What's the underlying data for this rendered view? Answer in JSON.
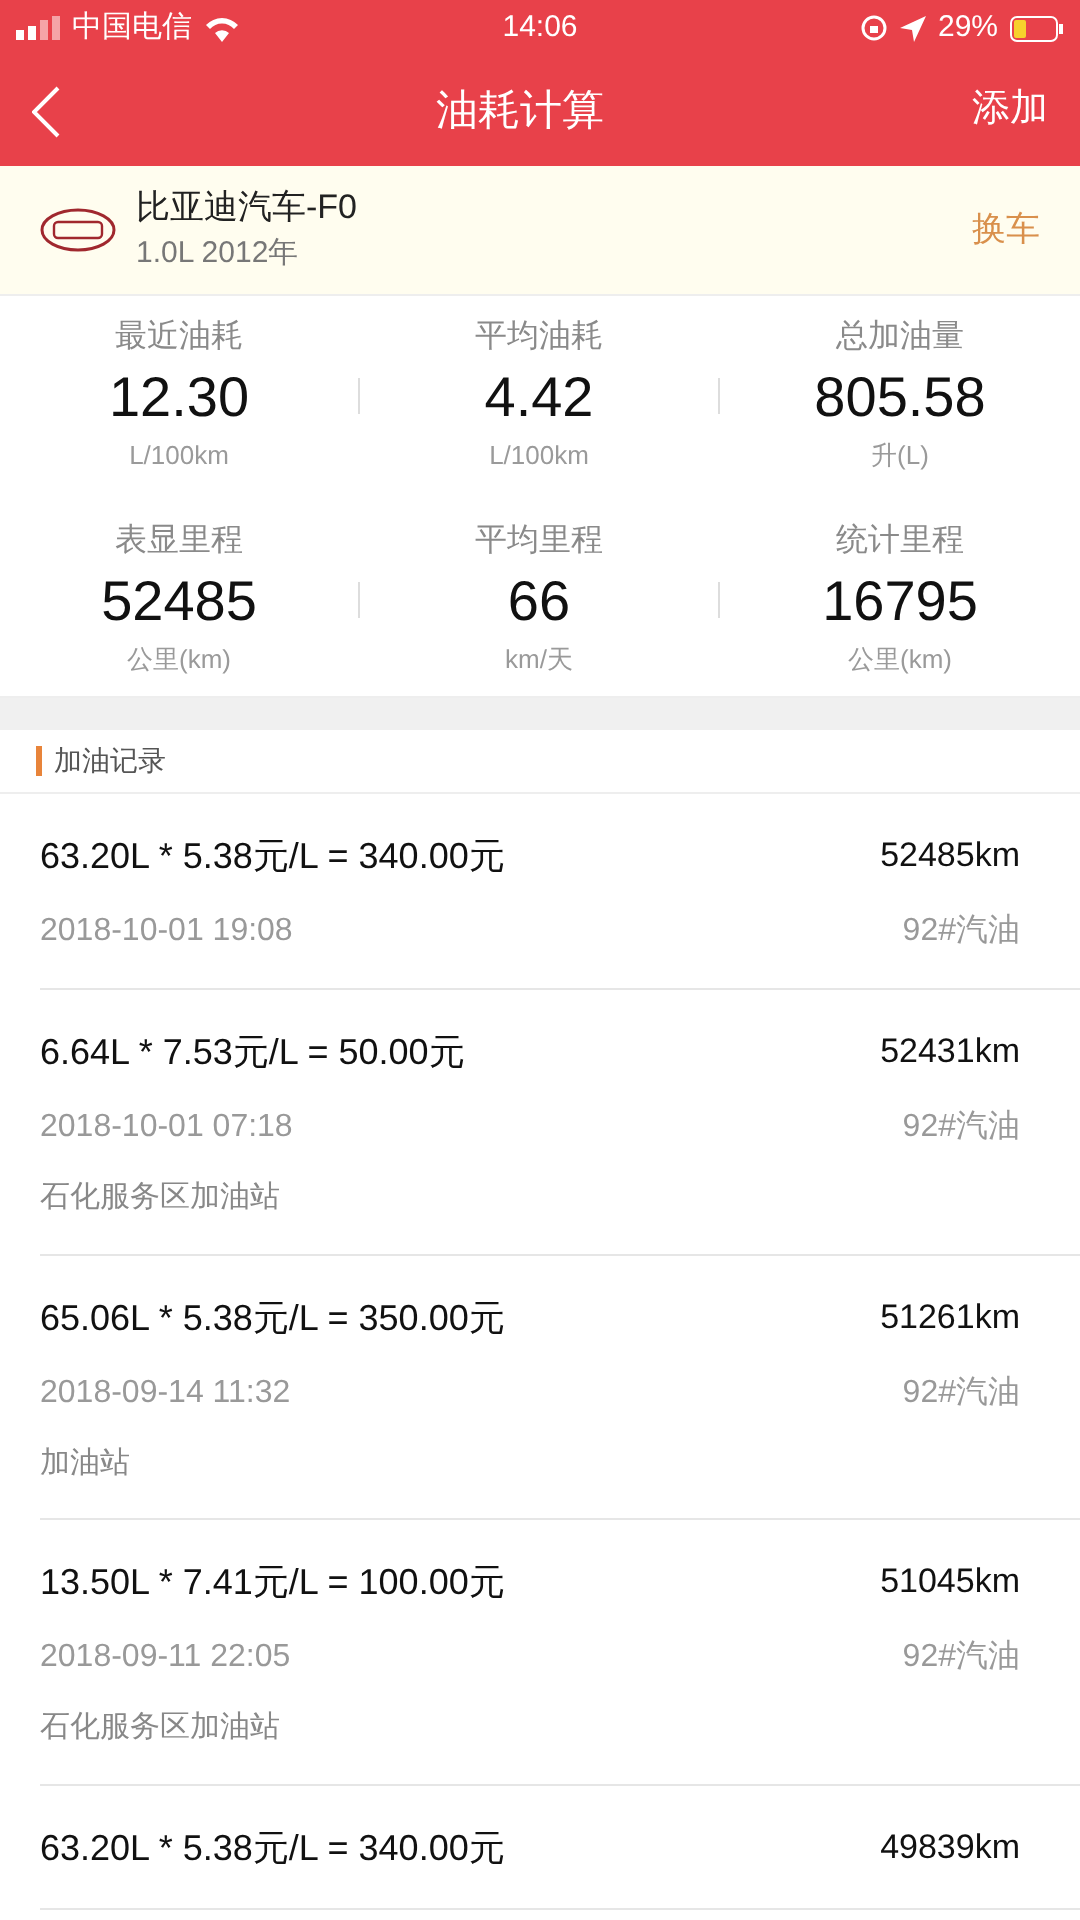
{
  "status_bar": {
    "carrier": "中国电信",
    "time": "14:06",
    "battery": "29%"
  },
  "nav": {
    "title": "油耗计算",
    "action": "添加"
  },
  "car": {
    "name": "比亚迪汽车-F0",
    "spec": "1.0L 2012年",
    "action": "换车"
  },
  "stats": [
    {
      "label": "最近油耗",
      "value": "12.30",
      "unit": "L/100km"
    },
    {
      "label": "平均油耗",
      "value": "4.42",
      "unit": "L/100km"
    },
    {
      "label": "总加油量",
      "value": "805.58",
      "unit": "升(L)"
    },
    {
      "label": "表显里程",
      "value": "52485",
      "unit": "公里(km)"
    },
    {
      "label": "平均里程",
      "value": "66",
      "unit": "km/天"
    },
    {
      "label": "统计里程",
      "value": "16795",
      "unit": "公里(km)"
    }
  ],
  "section_title": "加油记录",
  "records": [
    {
      "amount": "63.20L * 5.38元/L = 340.00元",
      "odometer": "52485km",
      "date": "2018-10-01 19:08",
      "fuel": "92#汽油"
    },
    {
      "amount": "6.64L * 7.53元/L = 50.00元",
      "odometer": "52431km",
      "date": "2018-10-01 07:18",
      "fuel": "92#汽油",
      "station": "石化服务区加油站"
    },
    {
      "amount": "65.06L * 5.38元/L = 350.00元",
      "odometer": "51261km",
      "date": "2018-09-14 11:32",
      "fuel": "92#汽油",
      "station": "加油站"
    },
    {
      "amount": "13.50L * 7.41元/L = 100.00元",
      "odometer": "51045km",
      "date": "2018-09-11 22:05",
      "fuel": "92#汽油",
      "station": "石化服务区加油站"
    },
    {
      "amount": "63.20L * 5.38元/L = 340.00元",
      "odometer": "49839km"
    }
  ]
}
